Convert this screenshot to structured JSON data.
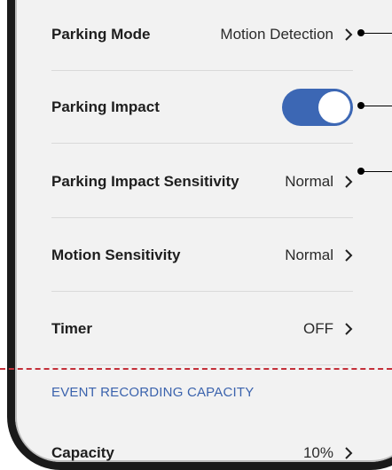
{
  "settings": {
    "rows": [
      {
        "label": "Parking Mode",
        "value": "Motion Detection",
        "control": "chevron"
      },
      {
        "label": "Parking Impact",
        "value": "",
        "control": "toggle",
        "toggle_on": true
      },
      {
        "label": "Parking Impact Sensitivity",
        "value": "Normal",
        "control": "chevron"
      },
      {
        "label": "Motion Sensitivity",
        "value": "Normal",
        "control": "chevron"
      },
      {
        "label": "Timer",
        "value": "OFF",
        "control": "chevron"
      }
    ],
    "section_header": "EVENT RECORDING CAPACITY",
    "capacity": {
      "label": "Capacity",
      "value": "10%",
      "control": "chevron"
    }
  },
  "colors": {
    "accent": "#3c67b4",
    "section_header": "#3b63ad",
    "divider_dashed": "#c4303a",
    "background": "#f2f2f2"
  },
  "icons": {
    "chevron": "chevron-right-icon",
    "toggle": "toggle-switch"
  }
}
